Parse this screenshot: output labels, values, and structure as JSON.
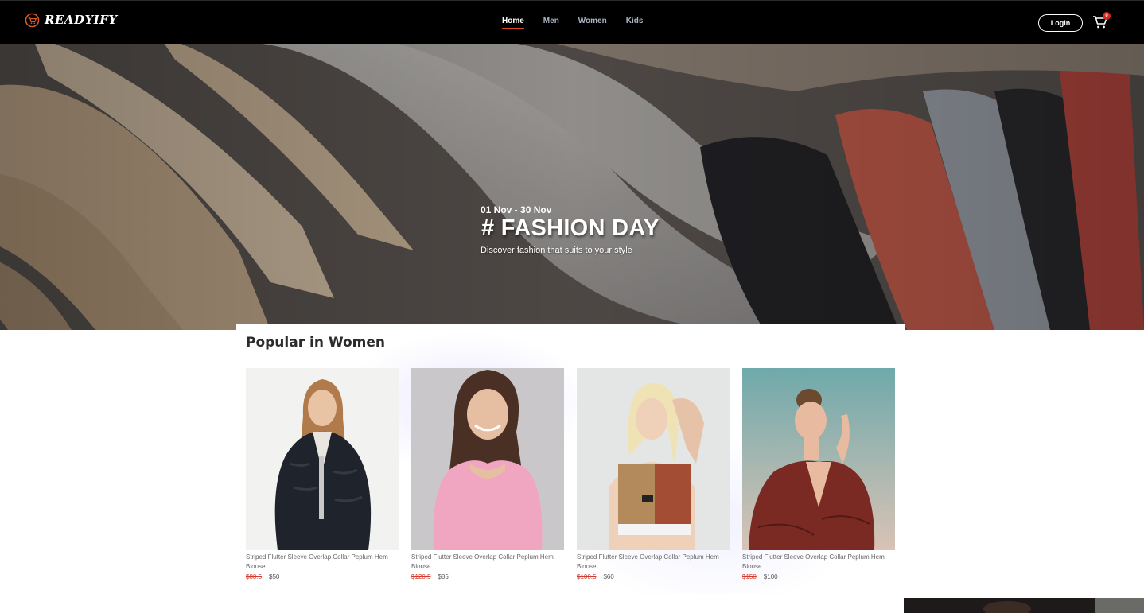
{
  "header": {
    "brand": "READYIFY",
    "nav": [
      {
        "label": "Home",
        "active": true
      },
      {
        "label": "Men",
        "active": false
      },
      {
        "label": "Women",
        "active": false
      },
      {
        "label": "Kids",
        "active": false
      }
    ],
    "login_label": "Login",
    "cart_count": "0",
    "icons": {
      "logo": "cart-logo-icon",
      "cart": "cart-icon"
    },
    "accent_color": "#d9461e"
  },
  "hero": {
    "date_range": "01 Nov - 30 Nov",
    "title": "# FASHION DAY",
    "subtitle": "Discover fashion that suits to your style"
  },
  "popular": {
    "title": "Popular in Women",
    "products": [
      {
        "name": "Striped Flutter Sleeve Overlap Collar Peplum Hem Blouse",
        "old_price": "$80.5",
        "new_price": "$50"
      },
      {
        "name": "Striped Flutter Sleeve Overlap Collar Peplum Hem Blouse",
        "old_price": "$120.5",
        "new_price": "$85"
      },
      {
        "name": "Striped Flutter Sleeve Overlap Collar Peplum Hem Blouse",
        "old_price": "$100.5",
        "new_price": "$60"
      },
      {
        "name": "Striped Flutter Sleeve Overlap Collar Peplum Hem Blouse",
        "old_price": "$150",
        "new_price": "$100"
      }
    ]
  }
}
